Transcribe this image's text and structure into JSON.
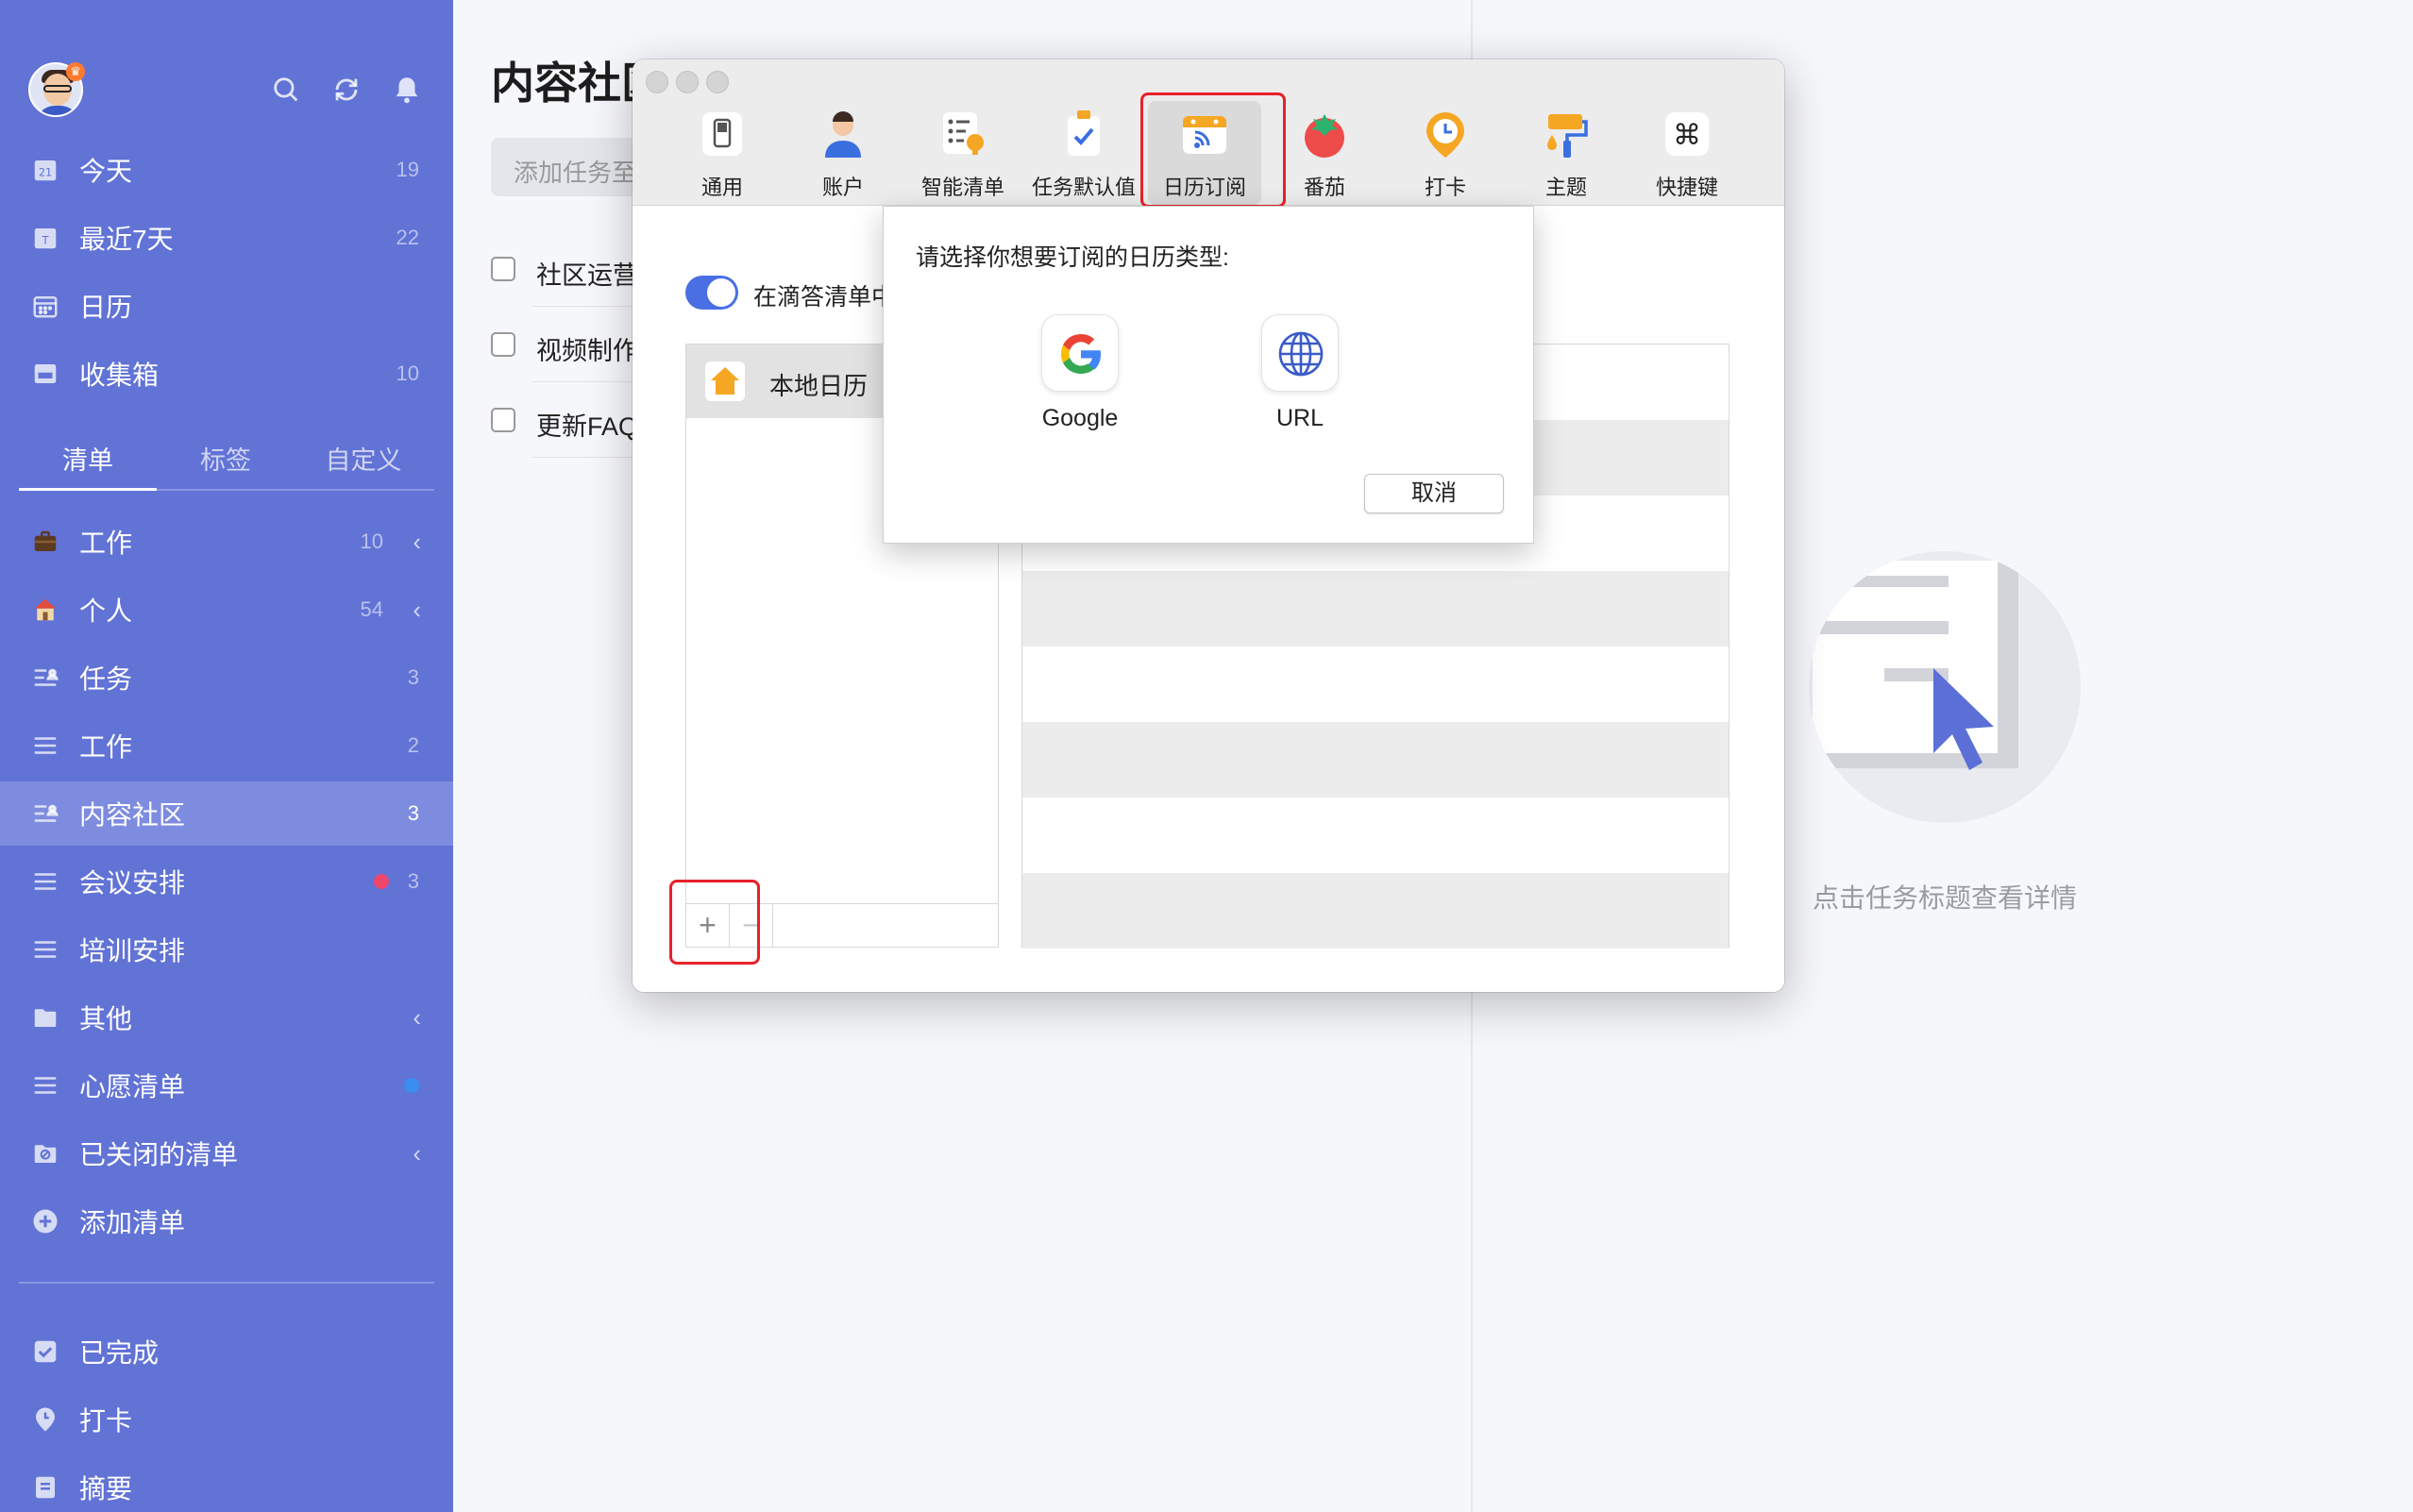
{
  "sidebar": {
    "smart_lists": [
      {
        "label": "今天",
        "count": "19",
        "icon": "calendar-21-icon"
      },
      {
        "label": "最近7天",
        "count": "22",
        "icon": "calendar-week-icon"
      },
      {
        "label": "日历",
        "count": "",
        "icon": "calendar-grid-icon"
      },
      {
        "label": "收集箱",
        "count": "10",
        "icon": "inbox-icon"
      }
    ],
    "tabs": [
      "清单",
      "标签",
      "自定义"
    ],
    "active_tab": "清单",
    "lists": [
      {
        "label": "工作",
        "count": "10",
        "icon": "briefcase-icon",
        "expandable": true
      },
      {
        "label": "个人",
        "count": "54",
        "icon": "house-icon",
        "expandable": true
      },
      {
        "label": "任务",
        "count": "3",
        "icon": "shared-list-icon"
      },
      {
        "label": "工作",
        "count": "2",
        "icon": "list-icon"
      },
      {
        "label": "内容社区",
        "count": "3",
        "icon": "shared-list-icon",
        "active": true
      },
      {
        "label": "会议安排",
        "count": "3",
        "icon": "list-icon",
        "dot_color": "#f0466e"
      },
      {
        "label": "培训安排",
        "count": "",
        "icon": "list-icon"
      },
      {
        "label": "其他",
        "count": "",
        "icon": "folder-icon",
        "expandable": true
      },
      {
        "label": "心愿清单",
        "count": "",
        "icon": "list-icon",
        "dot_color": "#3b8ef0"
      },
      {
        "label": "已关闭的清单",
        "count": "",
        "icon": "archive-icon",
        "expandable": true
      },
      {
        "label": "添加清单",
        "count": "",
        "icon": "plus-circle-icon"
      }
    ],
    "bottom": [
      {
        "label": "已完成",
        "icon": "checkbox-icon"
      },
      {
        "label": "打卡",
        "icon": "habit-icon"
      },
      {
        "label": "摘要",
        "icon": "summary-icon"
      }
    ]
  },
  "main": {
    "title": "内容社区",
    "add_task_placeholder": "添加任务至",
    "tasks": [
      "社区运营",
      "视频制作",
      "更新FAQ"
    ]
  },
  "detail": {
    "empty_hint": "点击任务标题查看详情"
  },
  "prefs": {
    "toolbar": [
      {
        "label": "通用",
        "icon": "general-switch-icon"
      },
      {
        "label": "账户",
        "icon": "account-person-icon"
      },
      {
        "label": "智能清单",
        "icon": "smart-list-icon"
      },
      {
        "label": "任务默认值",
        "icon": "task-defaults-icon"
      },
      {
        "label": "日历订阅",
        "icon": "calendar-subscribe-icon",
        "selected": true
      },
      {
        "label": "番茄",
        "icon": "tomato-icon"
      },
      {
        "label": "打卡",
        "icon": "habit-clock-icon"
      },
      {
        "label": "主题",
        "icon": "theme-roller-icon"
      },
      {
        "label": "快捷键",
        "icon": "command-key-icon"
      }
    ],
    "toggle_label": "在滴答清单中",
    "calendars": [
      {
        "name": "本地日历",
        "icon": "home-icon"
      }
    ],
    "add_symbol": "+",
    "remove_symbol": "−"
  },
  "sheet": {
    "prompt": "请选择你想要订阅的日历类型:",
    "options": [
      {
        "label": "Google",
        "icon": "google-icon"
      },
      {
        "label": "URL",
        "icon": "globe-icon"
      }
    ],
    "cancel": "取消"
  },
  "colors": {
    "sidebar": "#6273d6",
    "sidebar_active": "#7e8ce0",
    "accent": "#4a6fe3",
    "highlight": "#e8212a"
  }
}
